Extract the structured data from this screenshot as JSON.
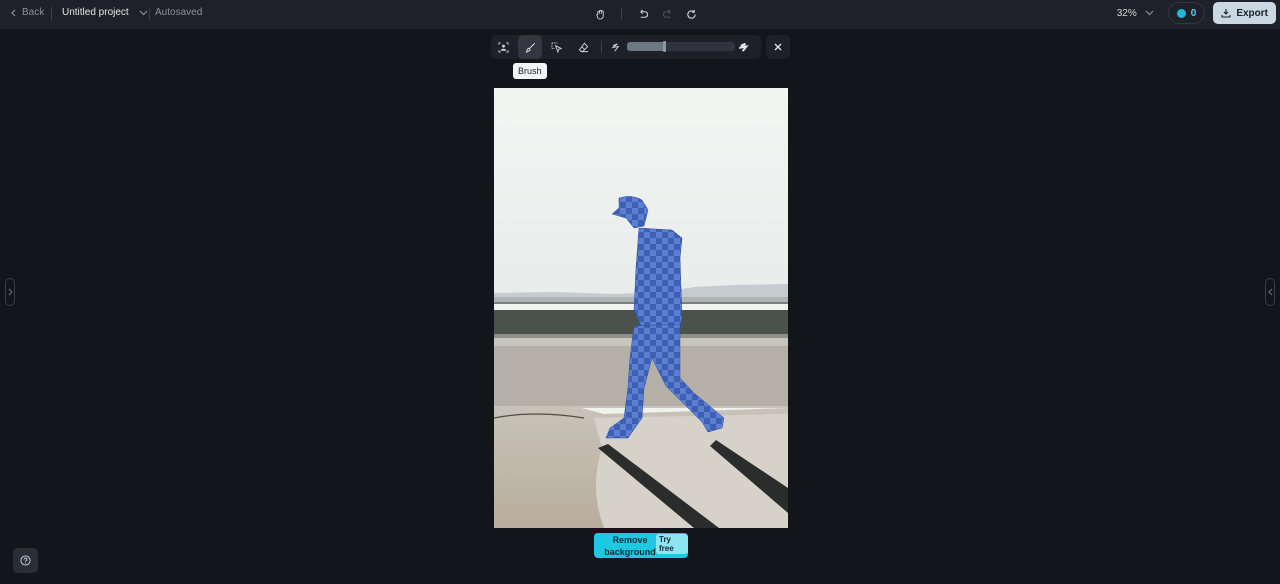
{
  "header": {
    "back_label": "Back",
    "project_title": "Untitled project",
    "save_status": "Autosaved",
    "zoom_level": "32%",
    "credits": "0",
    "export_label": "Export"
  },
  "toolbar": {
    "tools": [
      {
        "name": "Select subject",
        "icon": "person-select-icon"
      },
      {
        "name": "Brush",
        "icon": "brush-icon",
        "active": true
      },
      {
        "name": "Lasso",
        "icon": "lasso-icon"
      },
      {
        "name": "Eraser",
        "icon": "eraser-icon"
      }
    ],
    "brush_size_percent": 34,
    "tooltip": "Brush"
  },
  "canvas": {
    "image_description": "Man in cap and hoodie walking on pavement, selected with blue checkered mask"
  },
  "remove_background": {
    "label": "Remove background",
    "badge": "Try free"
  },
  "colors": {
    "accent": "#1ec8e2",
    "mask": "#3b63c6"
  }
}
